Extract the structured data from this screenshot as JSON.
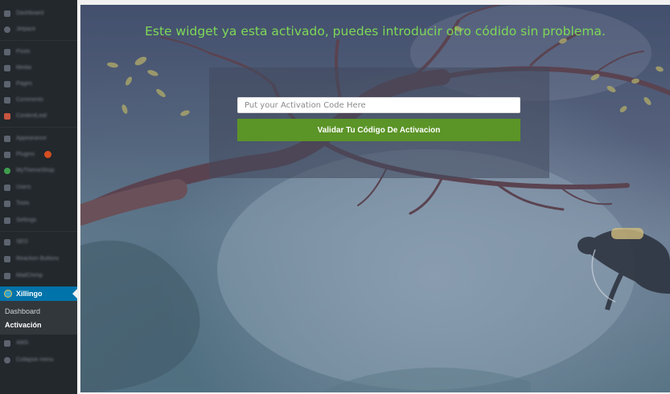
{
  "sidebar": {
    "items": [
      {
        "label": "Dashboard"
      },
      {
        "label": "Jetpack"
      },
      {
        "label": "Posts"
      },
      {
        "label": "Media"
      },
      {
        "label": "Pages"
      },
      {
        "label": "Comments"
      },
      {
        "label": "ContentLeaf"
      },
      {
        "label": "Appearance"
      },
      {
        "label": "Plugins"
      },
      {
        "label": "MyThemeShop"
      },
      {
        "label": "Users"
      },
      {
        "label": "Tools"
      },
      {
        "label": "Settings"
      },
      {
        "label": "SEO"
      },
      {
        "label": "Reaction Buttons"
      },
      {
        "label": "MailChimp"
      }
    ],
    "active": {
      "label": "Xillingo"
    },
    "submenu": [
      {
        "label": "Dashboard"
      },
      {
        "label": "Activación"
      }
    ],
    "after": [
      {
        "label": "AMS"
      },
      {
        "label": "Collapse menu"
      }
    ]
  },
  "main": {
    "heading": "Este widget ya esta activado, puedes introducir otro códido sin problema.",
    "input": {
      "placeholder": "Put your Activation Code Here",
      "value": ""
    },
    "button": {
      "label": "Validar Tu Código De Activacion"
    }
  },
  "colors": {
    "sidebar_bg": "#23282d",
    "active_bg": "#0073aa",
    "heading": "#7ed957",
    "button_bg": "#5b9427"
  }
}
